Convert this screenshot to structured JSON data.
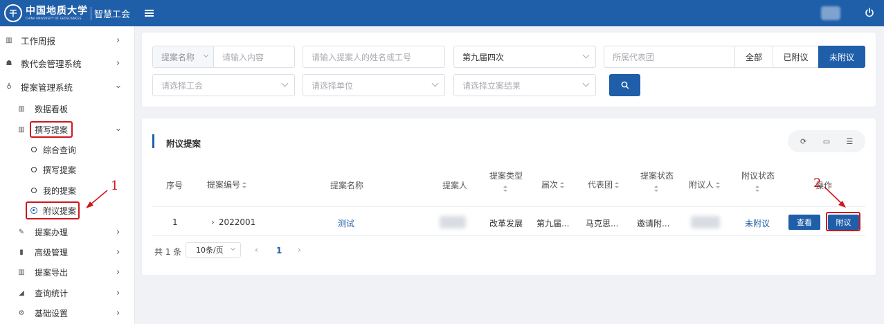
{
  "header": {
    "logo_cn": "中国地质大学",
    "logo_en": "CHINA UNIVERSITY OF GEOSCIENCES",
    "logo_seal": "干",
    "app_name": "智慧工会"
  },
  "sidebar": {
    "items": [
      {
        "label": "工作周报",
        "icon": "book-icon"
      },
      {
        "label": "教代会管理系统",
        "icon": "users-icon"
      },
      {
        "label": "提案管理系统",
        "icon": "bulb-icon"
      },
      {
        "label": "数据看板",
        "icon": "bar-chart-icon"
      },
      {
        "label": "撰写提案",
        "icon": "book-icon"
      },
      {
        "label": "综合查询"
      },
      {
        "label": "撰写提案"
      },
      {
        "label": "我的提案"
      },
      {
        "label": "附议提案"
      },
      {
        "label": "提案办理",
        "icon": "edit-icon"
      },
      {
        "label": "高级管理",
        "icon": "trash-icon"
      },
      {
        "label": "提案导出",
        "icon": "book-icon"
      },
      {
        "label": "查询统计",
        "icon": "area-chart-icon"
      },
      {
        "label": "基础设置",
        "icon": "gear-icon"
      }
    ]
  },
  "filters": {
    "name_prefix": "提案名称",
    "name_placeholder": "请输入内容",
    "proposer_placeholder": "请输入提案人的姓名或工号",
    "session_value": "第九届四次",
    "delegation_placeholder": "所属代表团",
    "union_placeholder": "请选择工会",
    "unit_placeholder": "请选择单位",
    "result_placeholder": "请选择立案结果",
    "segments": [
      "全部",
      "已附议",
      "未附议"
    ],
    "active_segment": "未附议"
  },
  "table": {
    "title": "附议提案",
    "headers": {
      "index": "序号",
      "code": "提案编号",
      "name": "提案名称",
      "proposer": "提案人",
      "type_l1": "提案类型",
      "session": "届次",
      "delegation": "代表团",
      "status_l1": "提案状态",
      "seconder": "附议人",
      "second_status": "附议状态",
      "action": "操作"
    },
    "rows": [
      {
        "index": "1",
        "code": "2022001",
        "name": "测试",
        "type": "改革发展",
        "session": "第九届...",
        "delegation": "马克思...",
        "status": "邀请附...",
        "second_status": "未附议",
        "view_label": "查看",
        "second_label": "附议"
      }
    ]
  },
  "pagination": {
    "total": "共 1 条",
    "page_size": "10条/页",
    "current": "1"
  },
  "annotations": {
    "label_1": "1",
    "label_2": "2",
    "color": "#d0161b"
  },
  "colors": {
    "primary": "#1f5ea8",
    "highlight": "#d0161b"
  }
}
